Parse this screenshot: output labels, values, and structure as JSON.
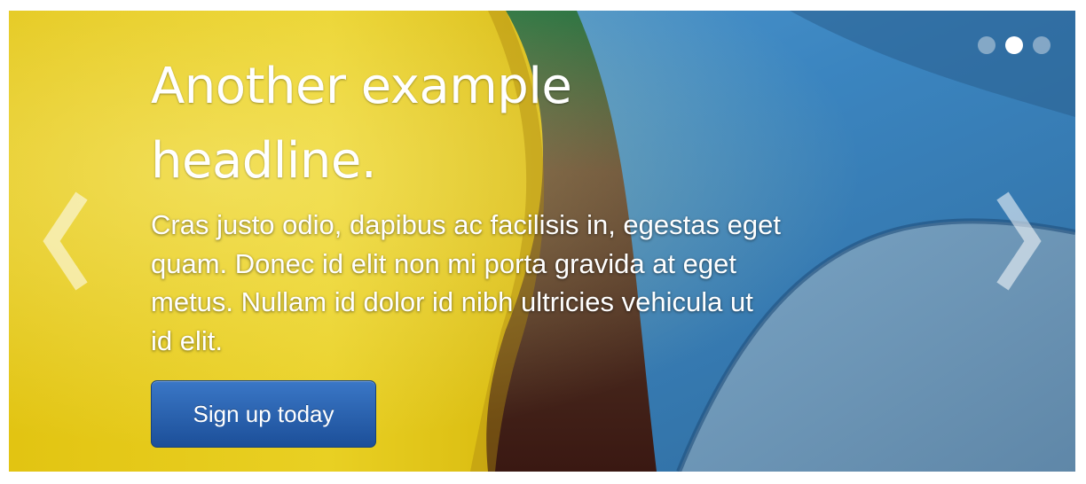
{
  "carousel": {
    "caption": {
      "headline": "Another example headline.",
      "lead": "Cras justo odio, dapibus ac facilisis in, egestas eget quam. Donec id elit non mi porta gravida at eget metus. Nullam id dolor id nibh ultricies vehicula ut id elit.",
      "button_label": "Sign up today"
    },
    "indicators": {
      "count": 3,
      "active_index": 1
    },
    "controls": {
      "prev_icon": "chevron-left-icon",
      "next_icon": "chevron-right-icon"
    },
    "colors": {
      "button": "#2a62b0",
      "text": "#ffffff",
      "indicator_active": "#ffffff",
      "indicator_inactive": "#9fb6c9"
    }
  }
}
